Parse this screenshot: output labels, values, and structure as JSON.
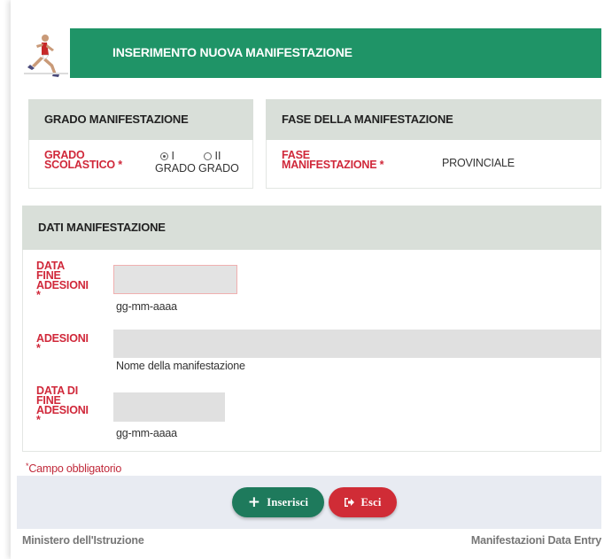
{
  "header": {
    "title": "INSERIMENTO NUOVA MANIFESTAZIONE",
    "logo_icon": "runner-icon"
  },
  "grado": {
    "heading": "GRADO MANIFESTAZIONE",
    "label_line1": "GRADO",
    "label_line2": "SCOLASTICO *",
    "options": [
      {
        "label_top": "I",
        "label_bottom": "GRADO",
        "selected": true
      },
      {
        "label_top": "II",
        "label_bottom": "GRADO",
        "selected": false
      }
    ]
  },
  "fase": {
    "heading": "FASE DELLA MANIFESTAZIONE",
    "label_line1": "FASE",
    "label_line2": "MANIFESTAZIONE *",
    "value": "PROVINCIALE"
  },
  "dati": {
    "heading": "DATI MANIFESTAZIONE",
    "fields": [
      {
        "label_lines": [
          "DATA",
          "FINE",
          "ADESIONI",
          "*"
        ],
        "value": "",
        "hint": "gg-mm-aaaa"
      },
      {
        "label_lines": [
          "ADESIONI",
          "*"
        ],
        "value": "",
        "hint": "Nome della manifestazione"
      },
      {
        "label_lines": [
          "DATA DI",
          "FINE",
          "ADESIONI",
          "*"
        ],
        "value": "",
        "hint": "gg-mm-aaaa"
      }
    ]
  },
  "required_note": "Campo obbligatorio",
  "buttons": {
    "insert_label": "Inserisci",
    "exit_label": "Esci",
    "insert_icon": "plus-icon",
    "exit_icon": "sign-out-icon"
  },
  "footer": {
    "left": "Ministero dell'Istruzione",
    "right": "Manifestazioni Data Entry"
  },
  "colors": {
    "header": "#1f9467",
    "label_red": "#d0283a",
    "insert_button": "#1e7a5c",
    "exit_button": "#d02c36",
    "panel_head": "#d9dfd9"
  }
}
